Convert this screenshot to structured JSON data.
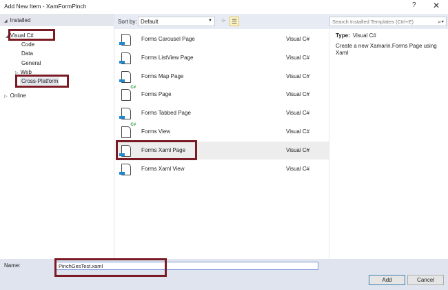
{
  "window": {
    "title": "Add New Item - XamFormPinch",
    "help": "?",
    "close": "✕"
  },
  "tree": {
    "installed": "Installed",
    "visual_csharp": "Visual C#",
    "code": "Code",
    "data": "Data",
    "general": "General",
    "web": "Web",
    "cross_platform": "Cross-Platform",
    "online": "Online"
  },
  "toolbar": {
    "sort_label": "Sort by:",
    "sort_value": "Default",
    "search_placeholder": "Search Installed Templates (Ctrl+E)"
  },
  "templates": [
    {
      "name": "Forms Carousel Page",
      "lang": "Visual C#",
      "icon": "xaml"
    },
    {
      "name": "Forms ListView Page",
      "lang": "Visual C#",
      "icon": "xaml"
    },
    {
      "name": "Forms Map Page",
      "lang": "Visual C#",
      "icon": "xaml"
    },
    {
      "name": "Forms Page",
      "lang": "Visual C#",
      "icon": "csharp"
    },
    {
      "name": "Forms Tabbed Page",
      "lang": "Visual C#",
      "icon": "xaml"
    },
    {
      "name": "Forms View",
      "lang": "Visual C#",
      "icon": "csharp"
    },
    {
      "name": "Forms Xaml Page",
      "lang": "Visual C#",
      "icon": "xaml",
      "selected": true
    },
    {
      "name": "Forms Xaml View",
      "lang": "Visual C#",
      "icon": "xaml"
    }
  ],
  "details": {
    "type_label": "Type:",
    "type_value": "Visual C#",
    "description": "Create a new Xamarin.Forms Page using Xaml"
  },
  "footer": {
    "name_label": "Name:",
    "name_value": "PinchGesTest.xaml",
    "add": "Add",
    "cancel": "Cancel"
  }
}
